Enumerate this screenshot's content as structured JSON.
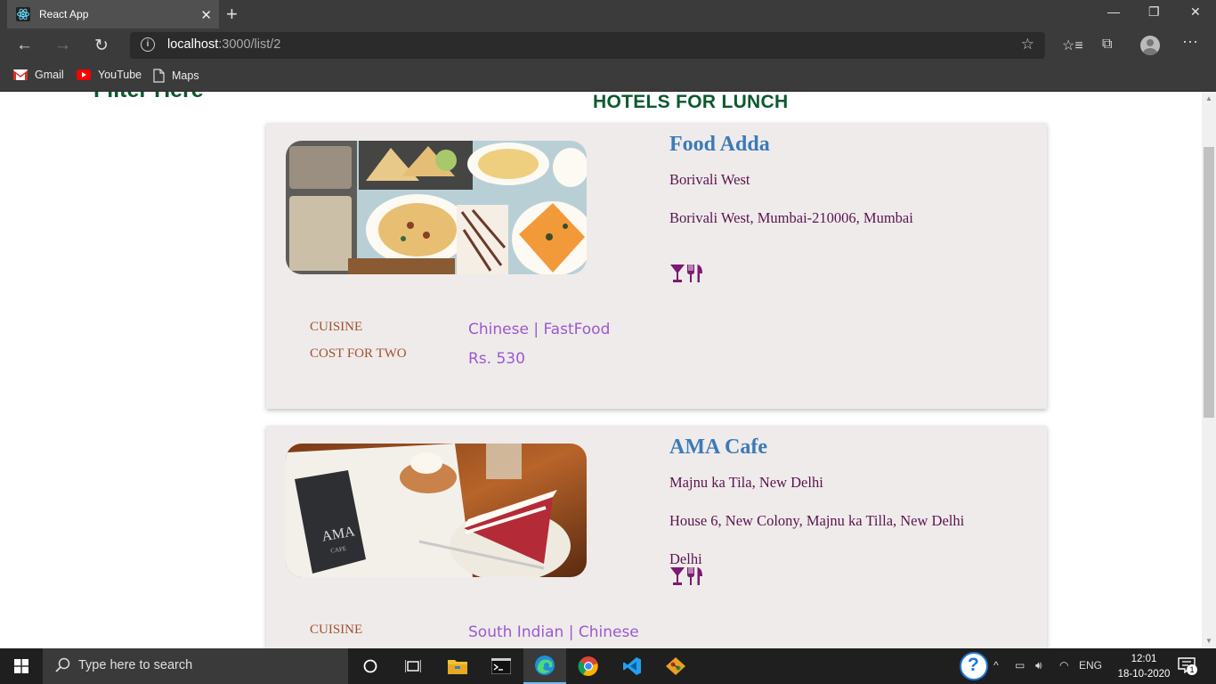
{
  "browser": {
    "tab_title": "React App",
    "url_host": "localhost",
    "url_path": ":3000/list/2",
    "bookmarks": [
      {
        "label": "Gmail",
        "icon": "gmail-icon"
      },
      {
        "label": "YouTube",
        "icon": "youtube-icon"
      },
      {
        "label": "Maps",
        "icon": "page-icon"
      }
    ]
  },
  "page": {
    "filter_title": "Filter Here",
    "section_title": "HOTELS FOR LUNCH",
    "cuisine_label": "CUISINE",
    "cost_label": "COST FOR TWO",
    "restaurants": [
      {
        "name": "Food Adda",
        "locality": "Borivali West",
        "address": "Borivali West, Mumbai-210006, Mumbai",
        "city": "",
        "cuisine": "Chinese | FastFood",
        "cost": "Rs. 530",
        "photo": "pizza-platter-photo"
      },
      {
        "name": "AMA Cafe",
        "locality": "Majnu ka Tila, New Delhi",
        "address": "House 6, New Colony, Majnu ka Tilla, New Delhi",
        "city": "Delhi",
        "cuisine": "South Indian | Chinese",
        "cost": "",
        "photo": "cafe-cake-photo",
        "logo_text": "AMA",
        "logo_subtext": "CAFE"
      }
    ]
  },
  "taskbar": {
    "search_placeholder": "Type here to search",
    "language": "ENG",
    "time": "12:01",
    "date": "18-10-2020",
    "notification_count": "1"
  },
  "colors": {
    "heading_green": "#0a5a2e",
    "name_blue": "#3b7ab8",
    "address_purple": "#5a1450",
    "label_brown": "#a0522d",
    "value_violet": "#9b59d0",
    "card_bg": "#efebea"
  }
}
